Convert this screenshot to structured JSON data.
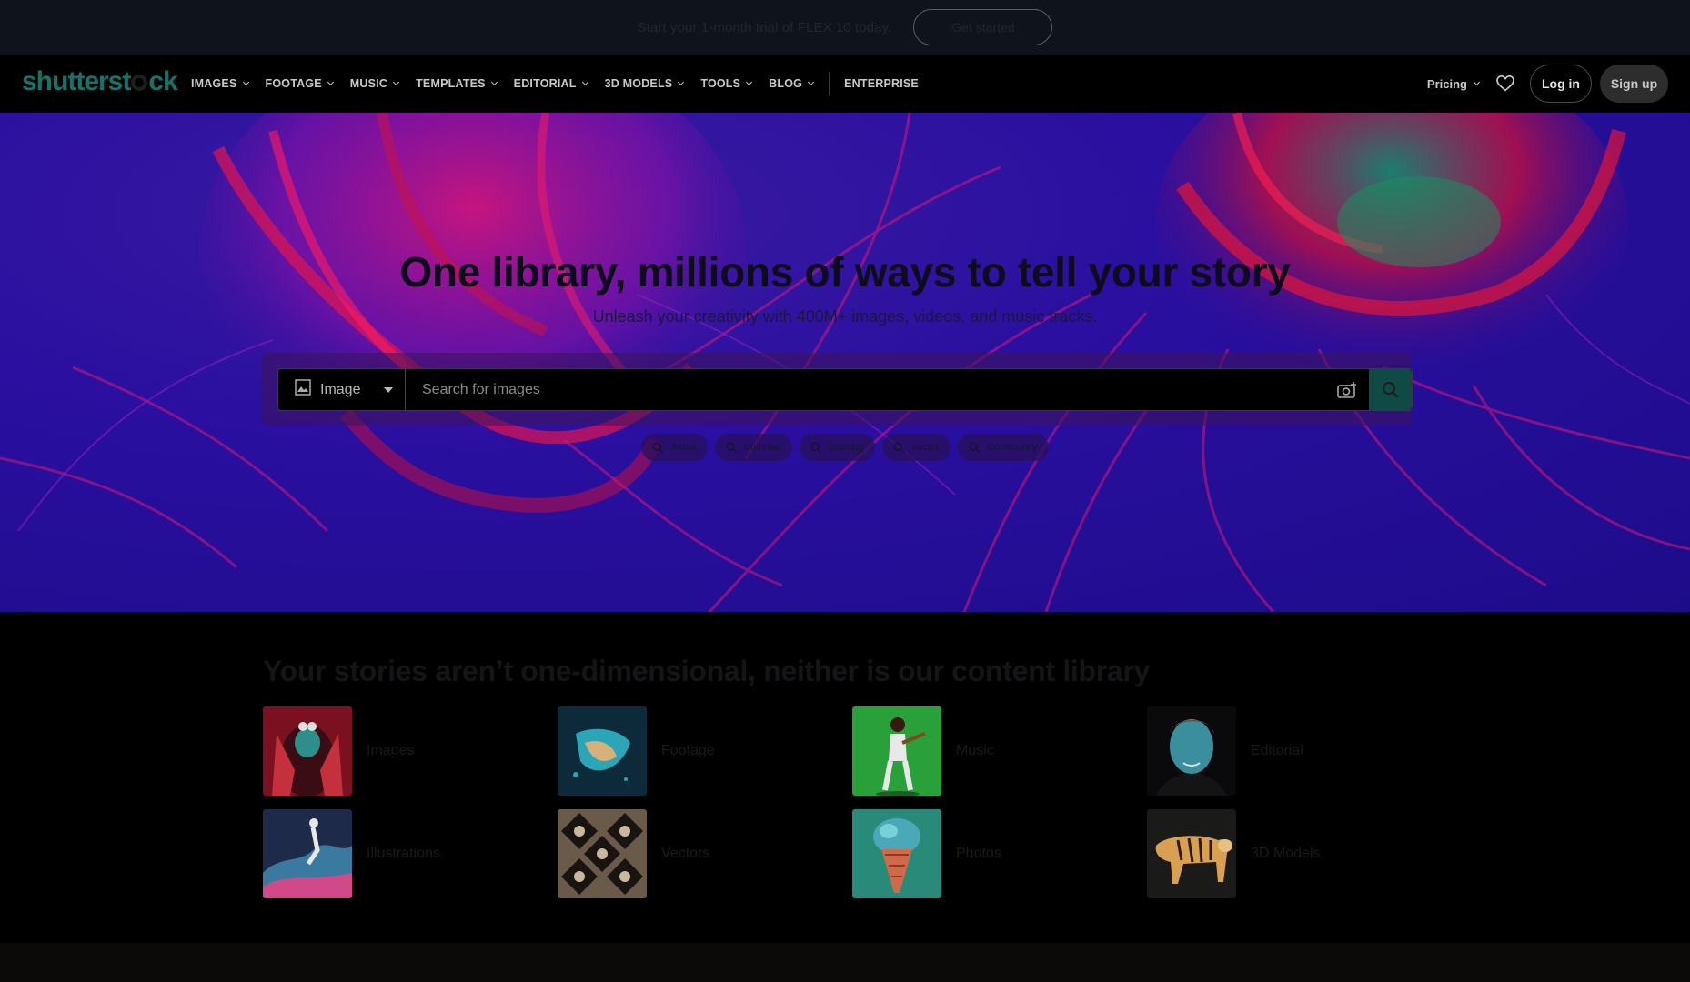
{
  "promo": {
    "text": "Start your 1-month trial of FLEX 10 today.",
    "button": "Get started"
  },
  "nav": {
    "logo": "shutterstock",
    "items": [
      {
        "label": "IMAGES",
        "dropdown": true
      },
      {
        "label": "FOOTAGE",
        "dropdown": true
      },
      {
        "label": "MUSIC",
        "dropdown": true
      },
      {
        "label": "TEMPLATES",
        "dropdown": true
      },
      {
        "label": "EDITORIAL",
        "dropdown": true
      },
      {
        "label": "3D MODELS",
        "dropdown": true
      },
      {
        "label": "TOOLS",
        "dropdown": true
      },
      {
        "label": "BLOG",
        "dropdown": true
      }
    ],
    "enterprise": "ENTERPRISE",
    "pricing": "Pricing",
    "login": "Log in",
    "signup": "Sign up"
  },
  "hero": {
    "title": "One library, millions of ways to tell your story",
    "subtitle": "Unleash your creativity with 400M+ images, videos, and music tracks.",
    "search": {
      "type_label": "Image",
      "placeholder": "Search for images"
    },
    "chips": [
      "Aerial",
      "Summer",
      "Gaming",
      "Vector",
      "Community"
    ]
  },
  "content": {
    "title": "Your stories aren’t one-dimensional, neither is our content library",
    "categories": [
      {
        "label": "Images"
      },
      {
        "label": "Footage"
      },
      {
        "label": "Music"
      },
      {
        "label": "Editorial"
      },
      {
        "label": "Illustrations"
      },
      {
        "label": "Vectors"
      },
      {
        "label": "Photos"
      },
      {
        "label": "3D Models"
      }
    ]
  },
  "colors": {
    "accent": "#17736a",
    "search_button": "#0f4a44",
    "hero_bg": "#2a0fa0"
  }
}
